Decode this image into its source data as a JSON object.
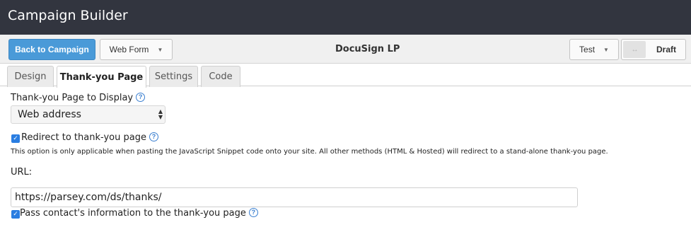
{
  "app": {
    "title": "Campaign Builder"
  },
  "toolbar": {
    "back_label": "Back to Campaign",
    "form_type": "Web Form",
    "page_name": "DocuSign LP",
    "test_label": "Test",
    "arrows": "↔",
    "status_label": "Draft"
  },
  "tabs": [
    {
      "label": "Design",
      "active": false
    },
    {
      "label": "Thank-you Page",
      "active": true
    },
    {
      "label": "Settings",
      "active": false
    },
    {
      "label": "Code",
      "active": false
    }
  ],
  "form": {
    "display_label": "Thank-you Page to Display",
    "display_value": "Web address",
    "redirect_label": "Redirect to thank-you page",
    "redirect_checked": true,
    "note": "This option is only applicable when pasting the JavaScript Snippet code onto your site. All other methods (HTML & Hosted) will redirect to a stand-alone thank-you page.",
    "url_label": "URL:",
    "url_value": "https://parsey.com/ds/thanks/",
    "pass_label": "Pass contact's information to the thank-you page",
    "pass_checked": true
  },
  "icons": {
    "help": "help-icon",
    "checkbox": "checkmark-icon",
    "caret": "caret-down-icon",
    "updown": "updown-arrows-icon"
  },
  "colors": {
    "titlebar": "#32353f",
    "primary": "#4a9ad8",
    "checkbox": "#2a7de1",
    "help": "#3a7fd0"
  }
}
